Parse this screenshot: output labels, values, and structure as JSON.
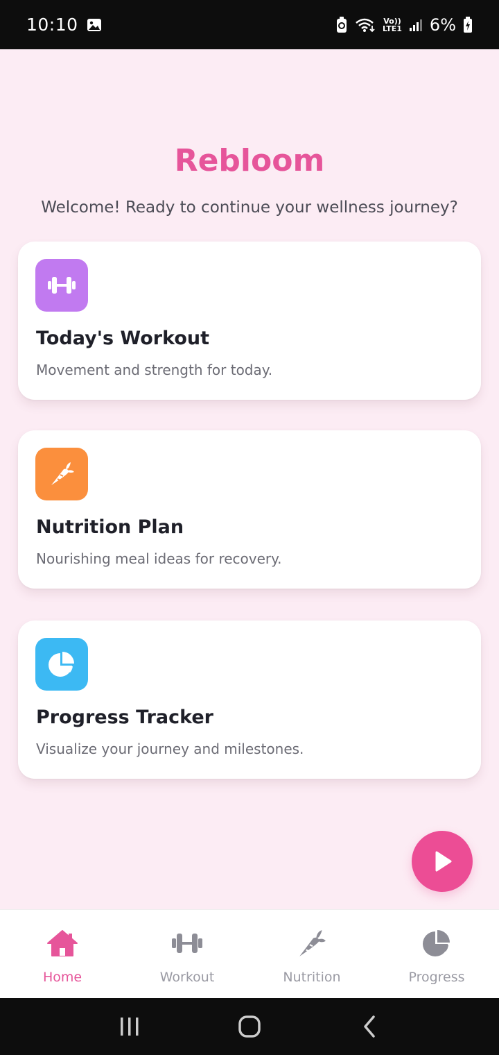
{
  "status_bar": {
    "time": "10:10",
    "battery_percent": "6%",
    "network_label_top": "Vo))",
    "network_label_bottom": "LTE1"
  },
  "app": {
    "brand": "Rebloom",
    "welcome": "Welcome! Ready to continue your wellness journey?",
    "accent_color": "#e6559a"
  },
  "cards": [
    {
      "title": "Today's Workout",
      "description": "Movement and strength for today.",
      "icon": "dumbbell-icon",
      "color": "#c17af0"
    },
    {
      "title": "Nutrition Plan",
      "description": "Nourishing meal ideas for recovery.",
      "icon": "carrot-icon",
      "color": "#fb8f3d"
    },
    {
      "title": "Progress Tracker",
      "description": "Visualize your journey and milestones.",
      "icon": "pie-chart-icon",
      "color": "#3cb9f3"
    }
  ],
  "fab": {
    "icon": "play-icon",
    "color": "#ec4d95"
  },
  "bottom_nav": {
    "active_index": 0,
    "items": [
      {
        "label": "Home",
        "icon": "home-icon"
      },
      {
        "label": "Workout",
        "icon": "dumbbell-icon"
      },
      {
        "label": "Nutrition",
        "icon": "carrot-icon"
      },
      {
        "label": "Progress",
        "icon": "pie-chart-icon"
      }
    ]
  },
  "system_nav": {
    "items": [
      {
        "icon": "recents-icon"
      },
      {
        "icon": "home-circle-icon"
      },
      {
        "icon": "back-icon"
      }
    ]
  }
}
